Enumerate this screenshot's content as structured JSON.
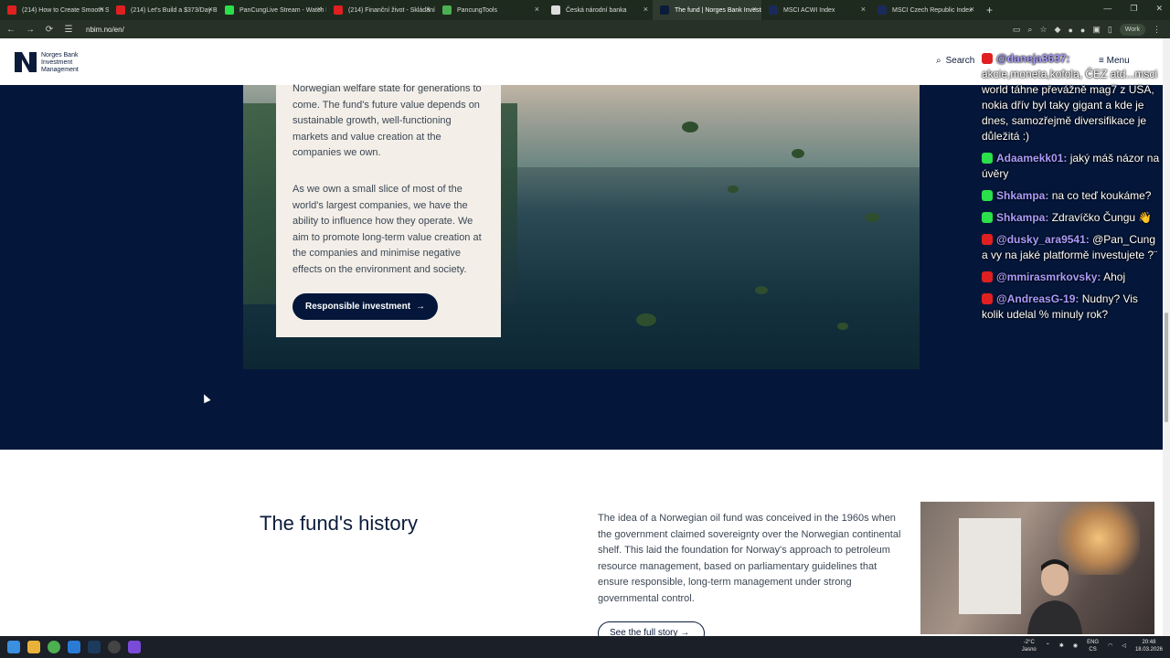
{
  "browser": {
    "tabs": [
      {
        "title": "(214) How to Create Smooth St",
        "color": "#e02020"
      },
      {
        "title": "(214) Let's Build a $373/Day Bu",
        "color": "#e02020"
      },
      {
        "title": "PanCungLive Stream - Watch Li",
        "color": "#2be04a"
      },
      {
        "title": "(214) Finanční život - Skládání",
        "color": "#e02020"
      },
      {
        "title": "PancungTools",
        "color": "#4caf50"
      },
      {
        "title": "Česká národní banka",
        "color": "#dddddd"
      },
      {
        "title": "The fund | Norges Bank Investm",
        "color": "#0b1b3a"
      },
      {
        "title": "MSCI ACWI Index",
        "color": "#1a2a5a"
      },
      {
        "title": "MSCI Czech Republic Index",
        "color": "#1a2a5a"
      }
    ],
    "active_tab": 6,
    "url": "nbim.no/en/",
    "profile_label": "Work",
    "new_tab": "+",
    "close": "×",
    "window_controls": [
      "—",
      "❐",
      "✕"
    ]
  },
  "site": {
    "logo_lines": [
      "Norges Bank",
      "Investment",
      "Management"
    ],
    "search_label": "Search",
    "menu_label": "Menu"
  },
  "card": {
    "p1": "Norwegian welfare state for generations to come. The fund's future value depends on sustainable growth, well-functioning markets and value creation at the companies we own.",
    "p2": "As we own a small slice of most of the world's largest companies, we have the ability to influence how they operate. We aim to promote long-term value creation at the companies and minimise negative effects on the environment and society.",
    "button_label": "Responsible investment",
    "button_arrow": "→"
  },
  "history": {
    "title": "The fund's history",
    "text": "The idea of a Norwegian oil fund was conceived in the 1960s when the government claimed sovereignty over the Norwegian continental shelf. This laid the foundation for Norway's approach to petroleum resource management, based on parliamentary guidelines that ensure responsible, long-term management under strong governmental control.",
    "button_label": "See the full story →"
  },
  "chat": [
    {
      "platform": "youtube",
      "user": "@daneja3637:",
      "text": "akcie,moneta,kofola, ČEZ atd...msci world táhne převážně mag7 z USA, nokia dřív byl taky gigant a kde je dnes, samozřejmě diversifikace je důležitá :)"
    },
    {
      "platform": "kick",
      "user": "Adaamekk01:",
      "text": "jaký máš názor na úvěry"
    },
    {
      "platform": "kick",
      "user": "Shkampa:",
      "text": "na co teď koukáme?"
    },
    {
      "platform": "kick",
      "user": "Shkampa:",
      "text": "Zdravíčko Čungu 👋"
    },
    {
      "platform": "youtube",
      "user": "@dusky_ara9541:",
      "text": "@Pan_Cung a vy na jaké platformě investujete ?¨"
    },
    {
      "platform": "youtube",
      "user": "@mmirasmrkovsky:",
      "text": "Ahoj"
    },
    {
      "platform": "youtube",
      "user": "@AndreasG-19:",
      "text": "Nudny? Vis kolik udelal % minuly rok?"
    }
  ],
  "taskbar": {
    "weather_temp": "-2°C",
    "weather_desc": "Jasno",
    "lang_top": "ENG",
    "lang_bottom": "CS",
    "time": "20:48",
    "date": "18.03.2026"
  }
}
